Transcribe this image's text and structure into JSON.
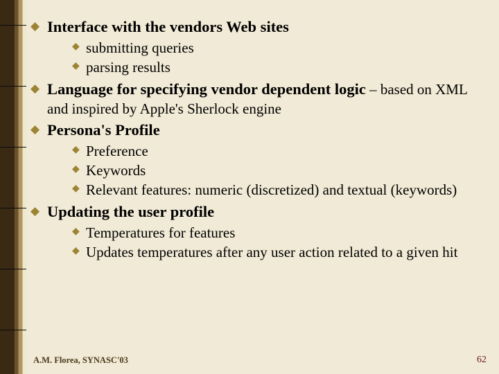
{
  "bullets": [
    {
      "title": "Interface with the vendors Web sites",
      "tail": "",
      "subs": [
        "submitting queries",
        "parsing results"
      ]
    },
    {
      "title": "Language for specifying vendor dependent logic",
      "tail": " – based on XML and inspired by Apple's Sherlock engine",
      "subs": []
    },
    {
      "title": "Persona's Profile",
      "tail": "",
      "subs": [
        "Preference",
        "Keywords",
        "Relevant features: numeric (discretized) and textual (keywords)"
      ]
    },
    {
      "title": "Updating the user profile",
      "tail": "",
      "subs": [
        "Temperatures for features",
        "Updates temperatures after any user action related to a given hit"
      ]
    }
  ],
  "tick_positions": [
    36,
    124,
    212,
    300,
    388,
    476
  ],
  "footer": {
    "left": "A.M. Florea, SYNASC'03",
    "right": "62"
  }
}
